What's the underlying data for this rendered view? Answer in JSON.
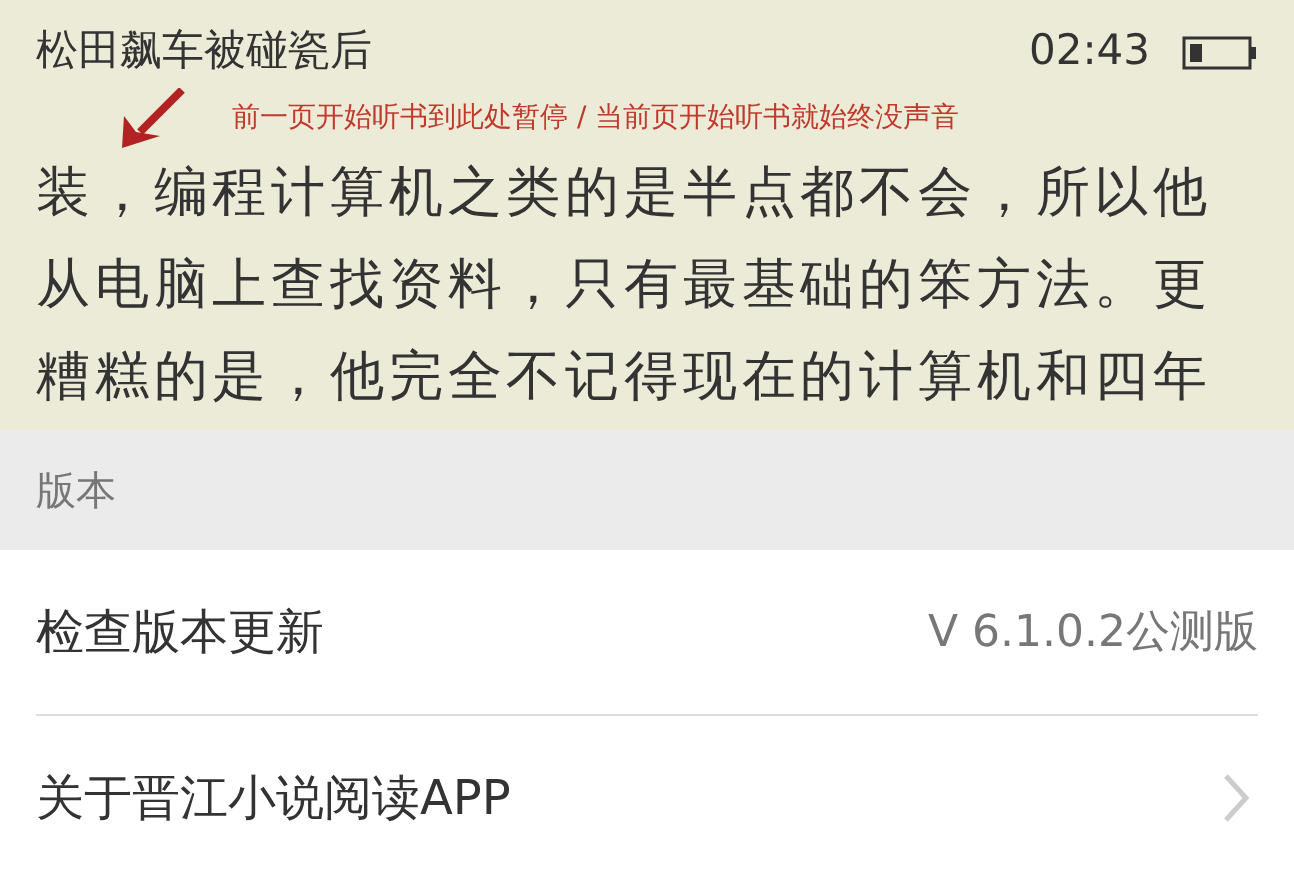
{
  "reader": {
    "chapter_title": "松田飙车被碰瓷后",
    "time": "02:43",
    "annotation": "前一页开始听书到此处暂停 / 当前页开始听书就始终没声音",
    "lines": [
      "装，编程计算机之类的是半点都不会，所以他",
      "从电脑上查找资料，只有最基础的笨方法。更",
      "糟糕的是，他完全不记得现在的计算机和四年"
    ]
  },
  "settings": {
    "section_title": "版本",
    "rows": [
      {
        "kind": "value",
        "label": "检查版本更新",
        "value": "V 6.1.0.2公测版"
      },
      {
        "kind": "link",
        "label": "关于晋江小说阅读APP"
      }
    ]
  }
}
